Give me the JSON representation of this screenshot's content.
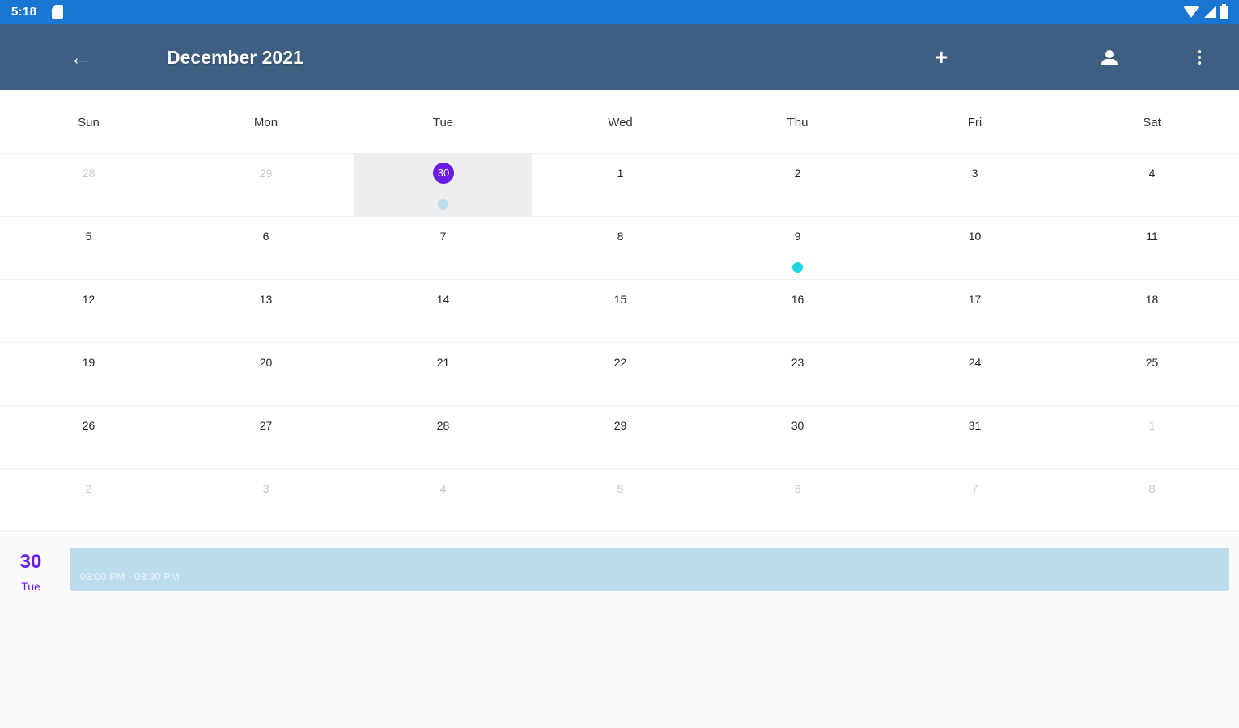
{
  "status_bar": {
    "time": "5:18"
  },
  "app_bar": {
    "title": "December 2021"
  },
  "calendar": {
    "weekdays": [
      "Sun",
      "Mon",
      "Tue",
      "Wed",
      "Thu",
      "Fri",
      "Sat"
    ],
    "weeks": [
      [
        {
          "n": "28",
          "other": true
        },
        {
          "n": "29",
          "other": true
        },
        {
          "n": "30",
          "selected": true,
          "dot": "#bcdcec"
        },
        {
          "n": "1"
        },
        {
          "n": "2"
        },
        {
          "n": "3"
        },
        {
          "n": "4"
        }
      ],
      [
        {
          "n": "5"
        },
        {
          "n": "6"
        },
        {
          "n": "7"
        },
        {
          "n": "8"
        },
        {
          "n": "9",
          "dot": "#1ed6d9"
        },
        {
          "n": "10"
        },
        {
          "n": "11"
        }
      ],
      [
        {
          "n": "12"
        },
        {
          "n": "13"
        },
        {
          "n": "14"
        },
        {
          "n": "15"
        },
        {
          "n": "16"
        },
        {
          "n": "17"
        },
        {
          "n": "18"
        }
      ],
      [
        {
          "n": "19"
        },
        {
          "n": "20"
        },
        {
          "n": "21"
        },
        {
          "n": "22"
        },
        {
          "n": "23"
        },
        {
          "n": "24"
        },
        {
          "n": "25"
        }
      ],
      [
        {
          "n": "26"
        },
        {
          "n": "27"
        },
        {
          "n": "28"
        },
        {
          "n": "29"
        },
        {
          "n": "30"
        },
        {
          "n": "31"
        },
        {
          "n": "1",
          "other": true
        }
      ],
      [
        {
          "n": "2",
          "other": true
        },
        {
          "n": "3",
          "other": true
        },
        {
          "n": "4",
          "other": true
        },
        {
          "n": "5",
          "other": true
        },
        {
          "n": "6",
          "other": true
        },
        {
          "n": "7",
          "other": true
        },
        {
          "n": "8",
          "other": true
        }
      ]
    ]
  },
  "agenda": {
    "date_num": "30",
    "date_day": "Tue",
    "events": [
      {
        "time": "03:00 PM - 03:30 PM",
        "color": "#bcdcec"
      }
    ]
  },
  "colors": {
    "status_bar": "#1976d2",
    "app_bar": "#3f5f82",
    "accent": "#6a1be6"
  }
}
